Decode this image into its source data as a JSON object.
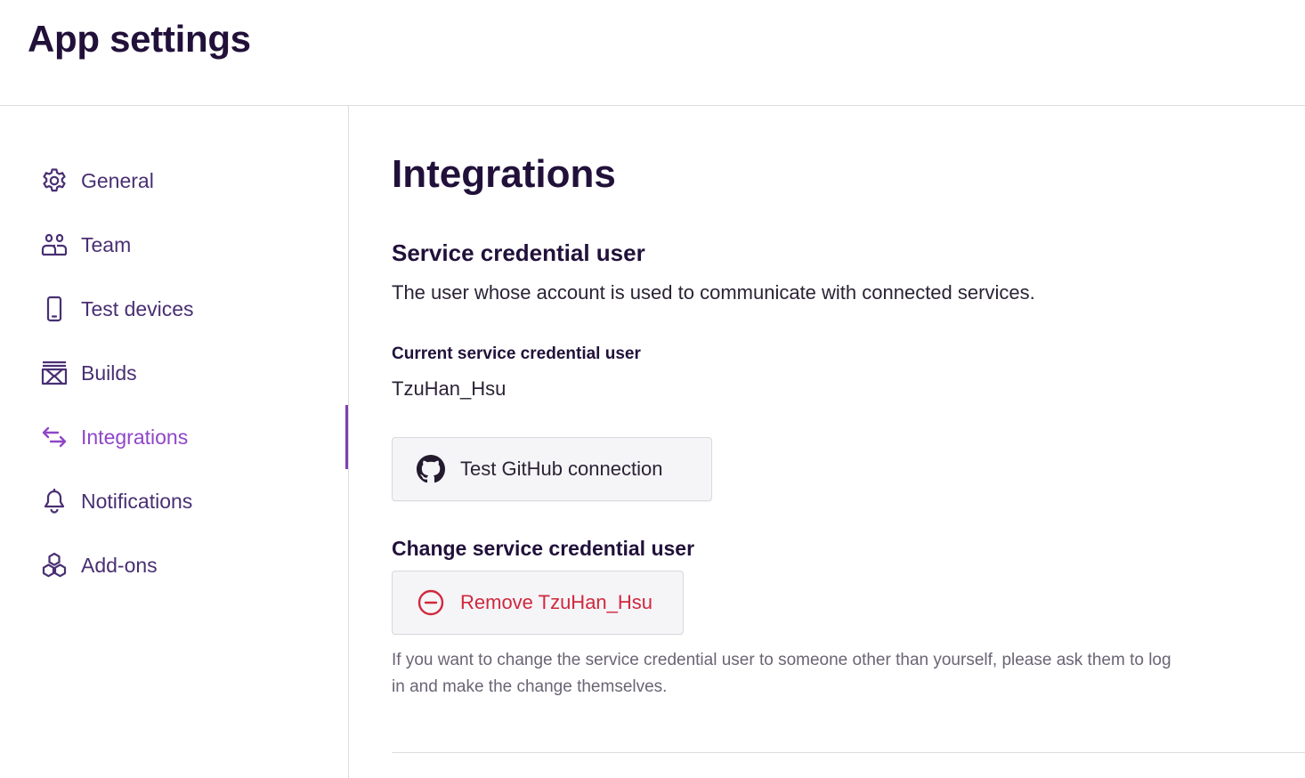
{
  "header": {
    "title": "App settings"
  },
  "sidebar": {
    "items": [
      {
        "label": "General",
        "icon": "gear-icon"
      },
      {
        "label": "Team",
        "icon": "team-icon"
      },
      {
        "label": "Test devices",
        "icon": "phone-icon"
      },
      {
        "label": "Builds",
        "icon": "builds-icon"
      },
      {
        "label": "Integrations",
        "icon": "arrows-exchange-icon",
        "active": true
      },
      {
        "label": "Notifications",
        "icon": "bell-icon"
      },
      {
        "label": "Add-ons",
        "icon": "hexagons-icon"
      }
    ]
  },
  "main": {
    "title": "Integrations",
    "section": {
      "title": "Service credential user",
      "description": "The user whose account is used to communicate with connected services."
    },
    "current_user": {
      "label": "Current service credential user",
      "value": "TzuHan_Hsu"
    },
    "github_button": {
      "label": "Test GitHub connection",
      "icon": "github-icon"
    },
    "change": {
      "title": "Change service credential user",
      "remove_button": {
        "label": "Remove TzuHan_Hsu",
        "icon": "minus-circle-icon"
      },
      "help": "If you want to change the service credential user to someone other than yourself, please ask them to log in and make the change themselves."
    }
  },
  "colors": {
    "nav_text": "#492f73",
    "nav_active": "#8f46c8",
    "heading": "#21113a",
    "danger": "#d0283d"
  }
}
